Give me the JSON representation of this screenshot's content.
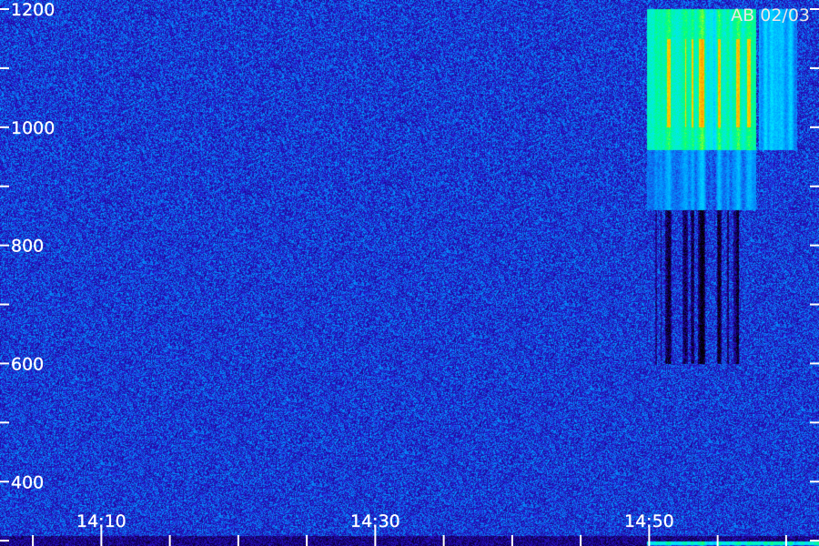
{
  "chart_data": {
    "type": "heatmap",
    "title": "",
    "xlabel": "",
    "ylabel": "",
    "date_label": "AB 02/03",
    "x_tick_labels": [
      "14:10",
      "14:30",
      "14:50"
    ],
    "y_tick_labels": [
      "400",
      "600",
      "800",
      "1000",
      "1200"
    ],
    "x_ticks": [
      {
        "label": "14:10",
        "value": 10
      },
      {
        "label": "14:30",
        "value": 30
      },
      {
        "label": "14:50",
        "value": 50
      }
    ],
    "x_minor_step": 5,
    "xlim": [
      2.6,
      62.4
    ],
    "y_ticks": [
      {
        "label": "400",
        "value": 400
      },
      {
        "label": "600",
        "value": 600
      },
      {
        "label": "800",
        "value": 800
      },
      {
        "label": "1000",
        "value": 1000
      },
      {
        "label": "1200",
        "value": 1200
      }
    ],
    "y_minor_step": 100,
    "ylim": [
      291,
      1200
    ],
    "axis_color": "#ffffff",
    "colormap": [
      "#000000",
      "#14006e",
      "#2a10c8",
      "#0096ff",
      "#00e6ff",
      "#00ff7a",
      "#eaff00",
      "#ffb000",
      "#ff2a00"
    ],
    "background_intensity": 0.28,
    "events": [
      {
        "x_start": 49.8,
        "x_end": 57.8,
        "y_start": 860,
        "y_end": 1200,
        "intensity": 0.78,
        "hot_core": [
          1000,
          1150
        ]
      },
      {
        "x_start": 58.0,
        "x_end": 60.8,
        "y_start": 860,
        "y_end": 1200,
        "intensity": 0.55
      },
      {
        "x_start": 49.8,
        "x_end": 62.4,
        "y_start": 291,
        "y_end": 300,
        "intensity": 0.72
      }
    ],
    "absorption": [
      {
        "x_start": 49.9,
        "x_end": 56.5,
        "y_start": 600,
        "y_end": 860,
        "depth": 0.7
      }
    ]
  }
}
